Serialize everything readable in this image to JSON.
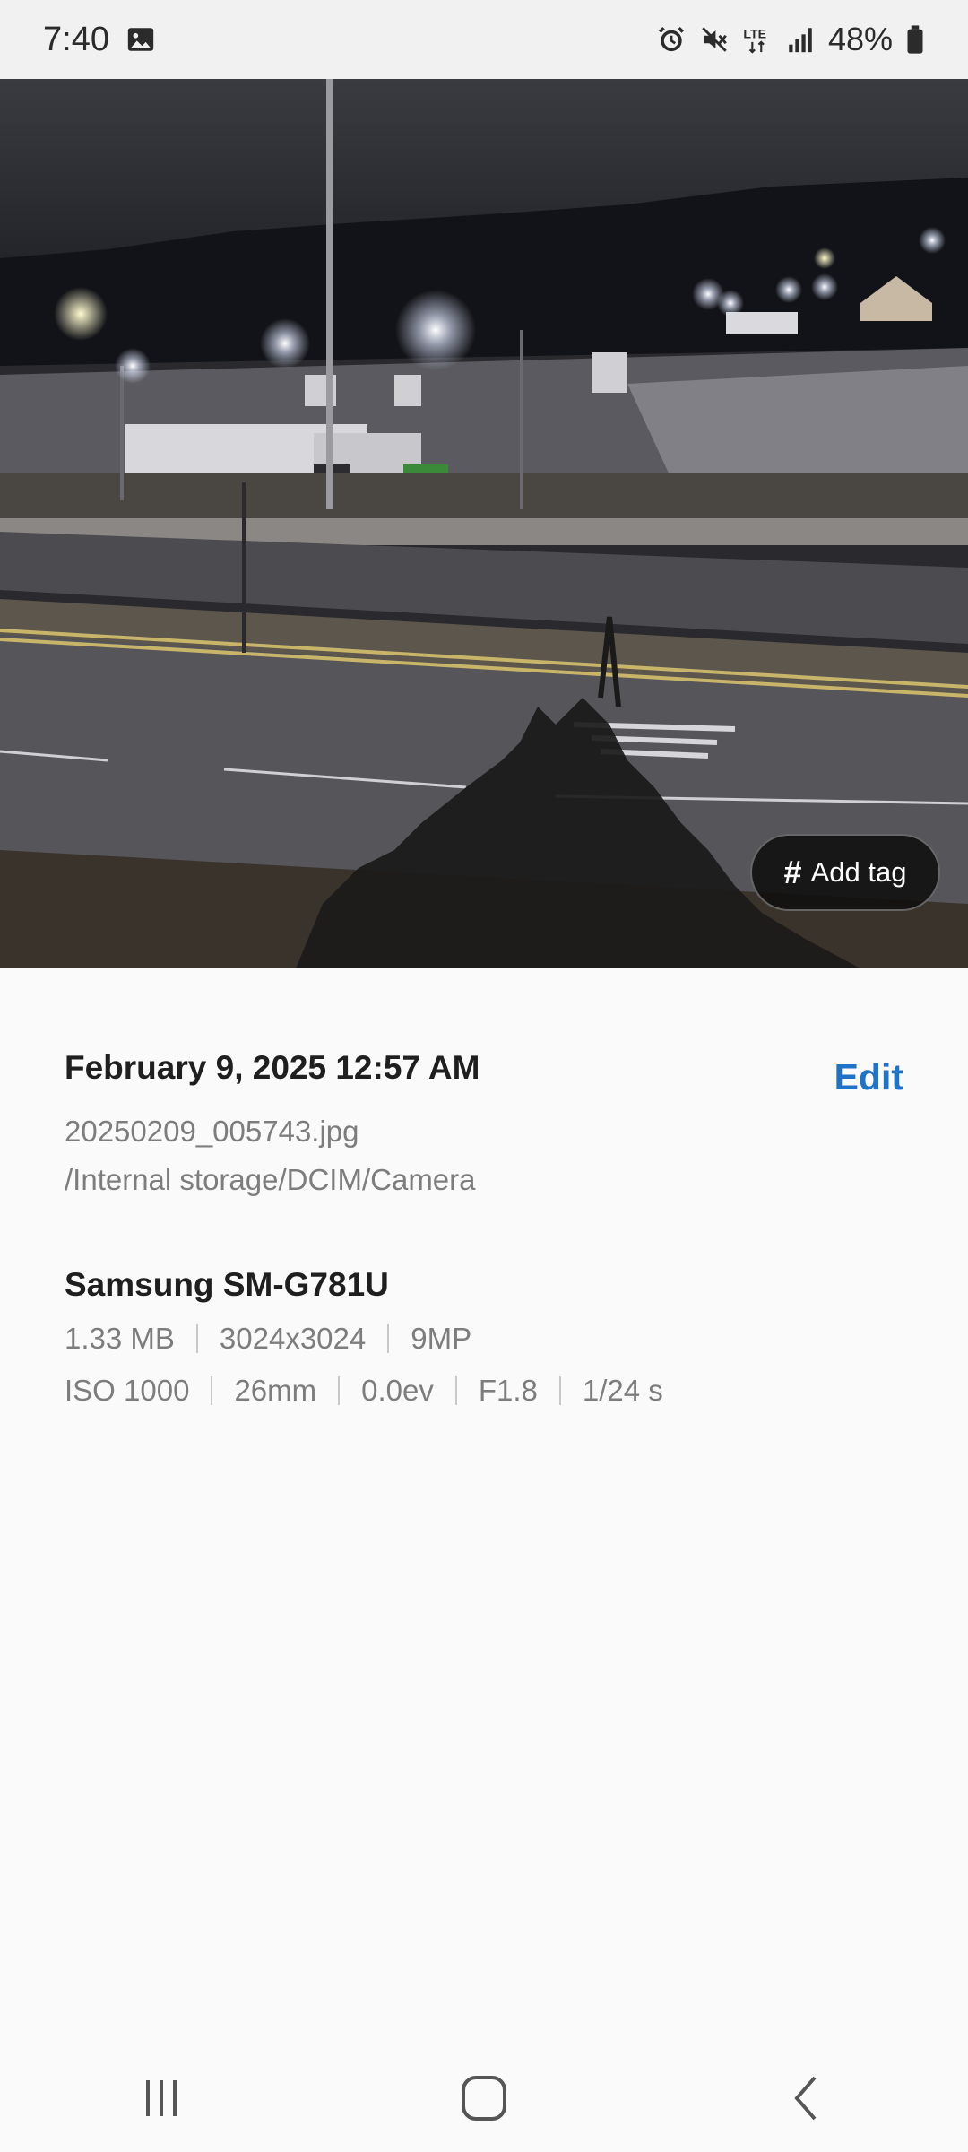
{
  "status_bar": {
    "time": "7:40",
    "battery": "48%",
    "icons": [
      "image-notification-icon",
      "alarm-icon",
      "mute-icon",
      "lte-icon",
      "signal-icon",
      "battery-icon"
    ]
  },
  "photo": {
    "add_tag_symbol": "#",
    "add_tag_label": "Add tag"
  },
  "details": {
    "date_time": "February 9, 2025 12:57 AM",
    "edit_label": "Edit",
    "filename": "20250209_005743.jpg",
    "path": "/Internal storage/DCIM/Camera"
  },
  "camera": {
    "model": "Samsung SM-G781U",
    "file_info": [
      "1.33 MB",
      "3024x3024",
      "9MP"
    ],
    "exposure_info": [
      "ISO 1000",
      "26mm",
      "0.0ev",
      "F1.8",
      "1/24 s"
    ]
  },
  "nav": {
    "recents": "recent-apps-icon",
    "home": "home-icon",
    "back": "back-icon"
  },
  "colors": {
    "accent": "#1e73c8",
    "secondary_text": "#7d7d7d",
    "primary_text": "#1f1f1f"
  }
}
